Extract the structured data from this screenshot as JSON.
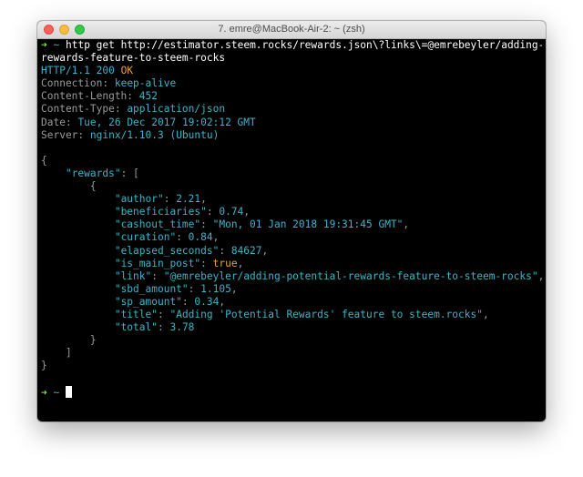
{
  "window": {
    "title": "7. emre@MacBook-Air-2: ~ (zsh)"
  },
  "prompt": {
    "arrow": "➜",
    "dir": "~"
  },
  "command": {
    "line1": "http get http://estimator.steem.rocks/rewards.json\\?links\\=@emrebeyler/adding-potential-",
    "line2": "rewards-feature-to-steem-rocks"
  },
  "response": {
    "protocol": "HTTP/1.1",
    "status_code": "200",
    "status_text": "OK",
    "headers": [
      {
        "name": "Connection",
        "value": "keep-alive"
      },
      {
        "name": "Content-Length",
        "value": "452"
      },
      {
        "name": "Content-Type",
        "value": "application/json"
      },
      {
        "name": "Date",
        "value": "Tue, 26 Dec 2017 19:02:12 GMT"
      },
      {
        "name": "Server",
        "value": "nginx/1.10.3 (Ubuntu)"
      }
    ]
  },
  "json": {
    "root_key": "\"rewards\"",
    "fields": [
      {
        "key": "\"author\"",
        "value": "2.21"
      },
      {
        "key": "\"beneficiaries\"",
        "value": "0.74"
      },
      {
        "key": "\"cashout_time\"",
        "value": "\"Mon, 01 Jan 2018 19:31:45 GMT\""
      },
      {
        "key": "\"curation\"",
        "value": "0.84"
      },
      {
        "key": "\"elapsed_seconds\"",
        "value": "84627"
      },
      {
        "key": "\"is_main_post\"",
        "value": "true"
      },
      {
        "key": "\"link\"",
        "value": "\"@emrebeyler/adding-potential-rewards-feature-to-steem-rocks\""
      },
      {
        "key": "\"sbd_amount\"",
        "value": "1.105"
      },
      {
        "key": "\"sp_amount\"",
        "value": "0.34"
      },
      {
        "key": "\"title\"",
        "value": "\"Adding 'Potential Rewards' feature to steem.rocks\""
      },
      {
        "key": "\"total\"",
        "value": "3.78"
      }
    ]
  }
}
